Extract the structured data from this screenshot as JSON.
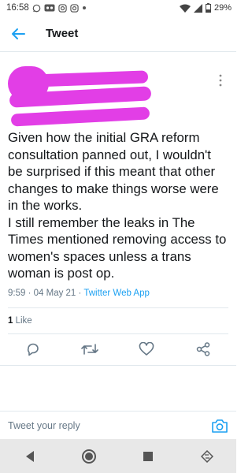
{
  "status_bar": {
    "time": "16:58",
    "battery": "29%",
    "icons": [
      "whatsapp-icon",
      "voicemail-icon",
      "instagram-icon",
      "instagram-icon",
      "dot-icon",
      "wifi-icon",
      "signal-icon",
      "battery-icon"
    ]
  },
  "app_bar": {
    "title": "Tweet",
    "back_icon": "back-arrow-icon"
  },
  "tweet": {
    "body": "Given how the initial GRA reform consultation panned out, I wouldn't be surprised if this meant that other changes to make things worse were in the works.\nI still remember the leaks in The Times mentioned removing access to women's spaces unless a trans woman is post op.",
    "time": "9:59",
    "date": "04 May 21",
    "source": "Twitter Web App",
    "likes_count": "1",
    "likes_label": "Like"
  },
  "actions": [
    "reply-icon",
    "retweet-icon",
    "like-icon",
    "share-icon"
  ],
  "reply": {
    "placeholder": "Tweet your reply"
  },
  "nav": [
    "back-triangle-icon",
    "home-circle-icon",
    "recents-square-icon",
    "rotate-icon"
  ],
  "colors": {
    "accent": "#1da1f2",
    "redaction": "#e23ee6",
    "muted": "#657786",
    "divider": "#e1e8ed"
  }
}
